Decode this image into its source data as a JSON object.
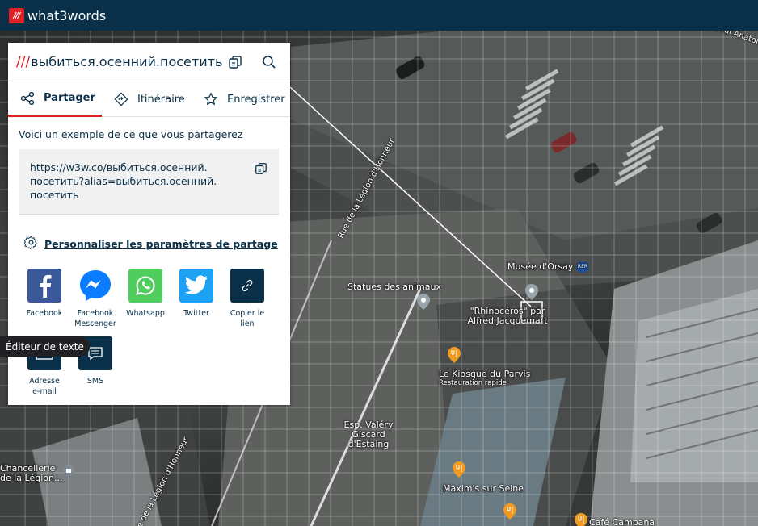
{
  "app": {
    "logo_mark": "///",
    "name": "what3words"
  },
  "panel": {
    "slashes": "///",
    "address": "выбиться.осенний.посетить",
    "tabs": [
      {
        "label": "Partager",
        "icon": "share-icon",
        "active": true
      },
      {
        "label": "Itinéraire",
        "icon": "directions-icon",
        "active": false
      },
      {
        "label": "Enregistrer",
        "icon": "star-icon",
        "active": false
      }
    ],
    "example_label": "Voici un exemple de ce que vous partagerez",
    "share_link": "https://w3w.co/выбиться.осенний.посетить?alias=выбиться.осенний.посетить",
    "share_link_lines": [
      "https://w3w.co/выбиться.осенний.",
      "посетить?alias=выбиться.осенний.",
      "посетить"
    ],
    "personalise_label": "Personnaliser les paramètres de partage",
    "share_options": [
      {
        "label": "Facebook",
        "icon": "facebook-icon",
        "color": "#3b5998"
      },
      {
        "label": "Facebook Messenger",
        "icon": "messenger-icon",
        "color": "#ffffff"
      },
      {
        "label": "Whatsapp",
        "icon": "whatsapp-icon",
        "color": "#4fce5d"
      },
      {
        "label": "Twitter",
        "icon": "twitter-icon",
        "color": "#1da1f2"
      },
      {
        "label": "Copier le lien",
        "icon": "link-icon",
        "color": "#0a3049"
      },
      {
        "label": "Adresse e-mail",
        "icon": "email-icon",
        "color": "#0a3049"
      },
      {
        "label": "SMS",
        "icon": "sms-icon",
        "color": "#0a3049"
      }
    ]
  },
  "tooltip": "Éditeur de texte",
  "map": {
    "labels": {
      "street_top_right": "Quai Anatole France",
      "rue_legion_1": "Rue de la Légion d'Honneur",
      "rue_legion_2": "Rue de la Légion d'Honneur",
      "musee": "Musée d'Orsay",
      "rer": "RER",
      "statues": "Statues des animaux",
      "rhinoceros": "\"Rhinocéros\" par Alfred Jacquemart",
      "kiosque": "Le Kiosque du Parvis",
      "kiosque_sub": "Restauration rapide",
      "esplanade": "Esp. Valéry Giscard d'Estaing",
      "chancellerie": "Chancellerie de la Légion...",
      "maxims": "Maxim's sur Seine",
      "cafe": "Café Campana"
    }
  },
  "colors": {
    "brand_red": "#e11f26",
    "brand_navy": "#0a3049"
  }
}
